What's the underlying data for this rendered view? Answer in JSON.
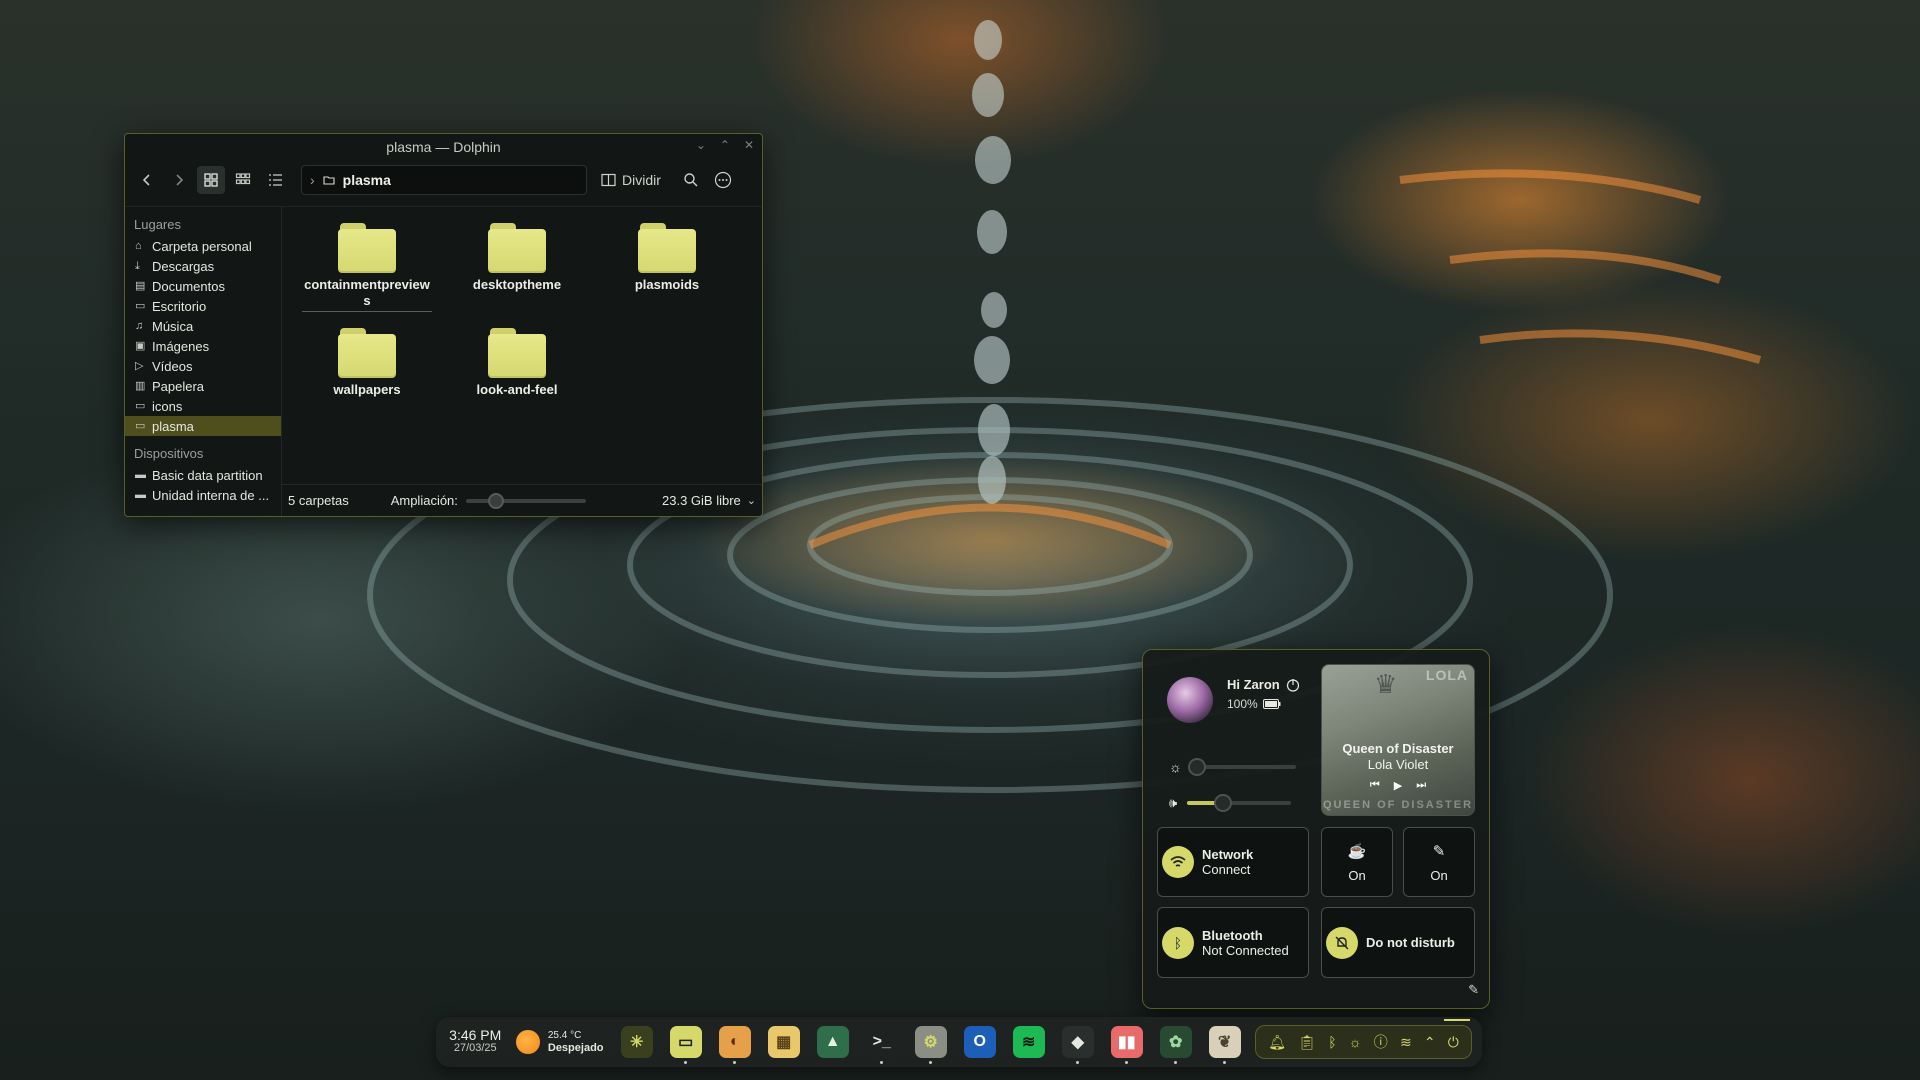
{
  "dolphin": {
    "title": "plasma — Dolphin",
    "location": "plasma",
    "split_label": "Dividir",
    "sidebar": {
      "places_header": "Lugares",
      "places": [
        {
          "label": "Carpeta personal",
          "icon": "home-icon"
        },
        {
          "label": "Descargas",
          "icon": "download-icon"
        },
        {
          "label": "Documentos",
          "icon": "document-icon"
        },
        {
          "label": "Escritorio",
          "icon": "desktop-icon"
        },
        {
          "label": "Música",
          "icon": "music-icon"
        },
        {
          "label": "Imágenes",
          "icon": "image-icon"
        },
        {
          "label": "Vídeos",
          "icon": "video-icon"
        },
        {
          "label": "Papelera",
          "icon": "trash-icon"
        },
        {
          "label": "icons",
          "icon": "folder-icon"
        },
        {
          "label": "plasma",
          "icon": "folder-icon",
          "selected": true
        }
      ],
      "devices_header": "Dispositivos",
      "devices": [
        {
          "label": "Basic data partition",
          "icon": "drive-icon"
        },
        {
          "label": "Unidad interna de ...",
          "icon": "drive-icon"
        }
      ]
    },
    "files": [
      "containmentpreviews",
      "desktoptheme",
      "plasmoids",
      "wallpapers",
      "look-and-feel"
    ],
    "status": {
      "count": "5 carpetas",
      "zoom_label": "Ampliación:",
      "zoom_level": 0.25,
      "free_space": "23.3 GiB libre"
    }
  },
  "control_center": {
    "greeting": "Hi Zaron",
    "battery": "100%",
    "brightness_level": 0.05,
    "volume_level": 0.35,
    "media": {
      "tag": "LOLA",
      "title": "Queen of Disaster",
      "artist": "Lola Violet",
      "footer": "QUEEN OF DISASTER"
    },
    "network": {
      "title": "Network",
      "subtitle": "Connect"
    },
    "caffeine": {
      "label": "On"
    },
    "night_light": {
      "label": "On"
    },
    "bluetooth": {
      "title": "Bluetooth",
      "subtitle": "Not Connected"
    },
    "dnd": {
      "title": "Do not disturb"
    }
  },
  "taskbar": {
    "time": "3:46 PM",
    "date": "27/03/25",
    "temperature": "25.4 °C",
    "weather": "Despejado",
    "apps": [
      {
        "name": "kde-icon",
        "color": "#3a3f1e",
        "fg": "#d6d86a",
        "glyph": "✳",
        "running": false
      },
      {
        "name": "files-icon",
        "color": "#d6d86a",
        "fg": "#1e221c",
        "glyph": "▭",
        "running": true
      },
      {
        "name": "firefox-icon",
        "color": "#e6a04a",
        "fg": "#5a2c08",
        "glyph": "◐",
        "running": true
      },
      {
        "name": "store-icon",
        "color": "#e8c86a",
        "fg": "#5a4418",
        "glyph": "▦",
        "running": false
      },
      {
        "name": "gallery-icon",
        "color": "#2f6e4a",
        "fg": "#e6f0e0",
        "glyph": "▲",
        "running": false
      },
      {
        "name": "terminal-icon",
        "color": "#1e2220",
        "fg": "#e6e8e0",
        "glyph": ">_",
        "running": true
      },
      {
        "name": "settings-icon",
        "color": "#8b8e85",
        "fg": "#d6d86a",
        "glyph": "⚙",
        "running": true
      },
      {
        "name": "outlook-icon",
        "color": "#1d5fb8",
        "fg": "#ffffff",
        "glyph": "O",
        "running": false
      },
      {
        "name": "spotify-icon",
        "color": "#1db954",
        "fg": "#0e1a12",
        "glyph": "≋",
        "running": false
      },
      {
        "name": "discover-icon",
        "color": "#2a2e2c",
        "fg": "#e6e8e0",
        "glyph": "◆",
        "running": true
      },
      {
        "name": "audio-icon",
        "color": "#e86a6a",
        "fg": "#ffffff",
        "glyph": "▮▮",
        "running": true
      },
      {
        "name": "turtle-icon",
        "color": "#284a32",
        "fg": "#9fd6a0",
        "glyph": "✿",
        "running": true
      },
      {
        "name": "feather-icon",
        "color": "#d8d0b8",
        "fg": "#4a4030",
        "glyph": "❦",
        "running": true
      }
    ],
    "tray": [
      "bell-icon",
      "clipboard-icon",
      "bluetooth-icon",
      "brightness-icon",
      "help-icon",
      "wifi-icon",
      "chevron-up-icon",
      "power-icon"
    ]
  }
}
